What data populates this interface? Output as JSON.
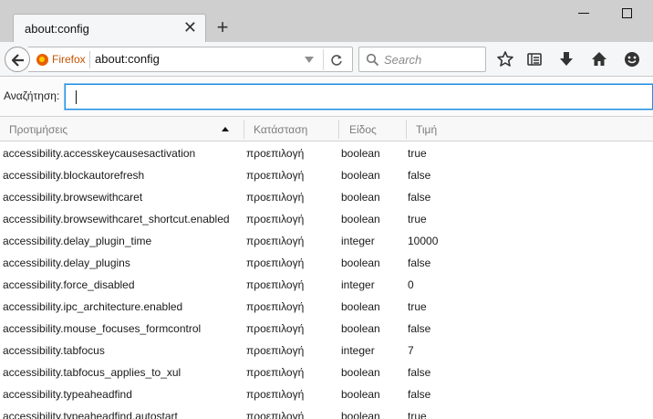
{
  "browser": {
    "tab_title": "about:config",
    "tab_close": "✕",
    "new_tab": "+",
    "identity_label": "Firefox",
    "url": "about:config",
    "search_placeholder": "Search"
  },
  "config": {
    "filter_label": "Αναζήτηση:",
    "filter_value": "",
    "columns": {
      "name": "Προτιμήσεις",
      "status": "Κατάσταση",
      "type": "Είδος",
      "value": "Τιμή"
    },
    "rows": [
      {
        "name": "accessibility.accesskeycausesactivation",
        "status": "προεπιλογή",
        "type": "boolean",
        "value": "true"
      },
      {
        "name": "accessibility.blockautorefresh",
        "status": "προεπιλογή",
        "type": "boolean",
        "value": "false"
      },
      {
        "name": "accessibility.browsewithcaret",
        "status": "προεπιλογή",
        "type": "boolean",
        "value": "false"
      },
      {
        "name": "accessibility.browsewithcaret_shortcut.enabled",
        "status": "προεπιλογή",
        "type": "boolean",
        "value": "true"
      },
      {
        "name": "accessibility.delay_plugin_time",
        "status": "προεπιλογή",
        "type": "integer",
        "value": "10000"
      },
      {
        "name": "accessibility.delay_plugins",
        "status": "προεπιλογή",
        "type": "boolean",
        "value": "false"
      },
      {
        "name": "accessibility.force_disabled",
        "status": "προεπιλογή",
        "type": "integer",
        "value": "0"
      },
      {
        "name": "accessibility.ipc_architecture.enabled",
        "status": "προεπιλογή",
        "type": "boolean",
        "value": "true"
      },
      {
        "name": "accessibility.mouse_focuses_formcontrol",
        "status": "προεπιλογή",
        "type": "boolean",
        "value": "false"
      },
      {
        "name": "accessibility.tabfocus",
        "status": "προεπιλογή",
        "type": "integer",
        "value": "7"
      },
      {
        "name": "accessibility.tabfocus_applies_to_xul",
        "status": "προεπιλογή",
        "type": "boolean",
        "value": "false"
      },
      {
        "name": "accessibility.typeaheadfind",
        "status": "προεπιλογή",
        "type": "boolean",
        "value": "false"
      },
      {
        "name": "accessibility.typeaheadfind.autostart",
        "status": "προεπιλογή",
        "type": "boolean",
        "value": "true"
      }
    ]
  }
}
